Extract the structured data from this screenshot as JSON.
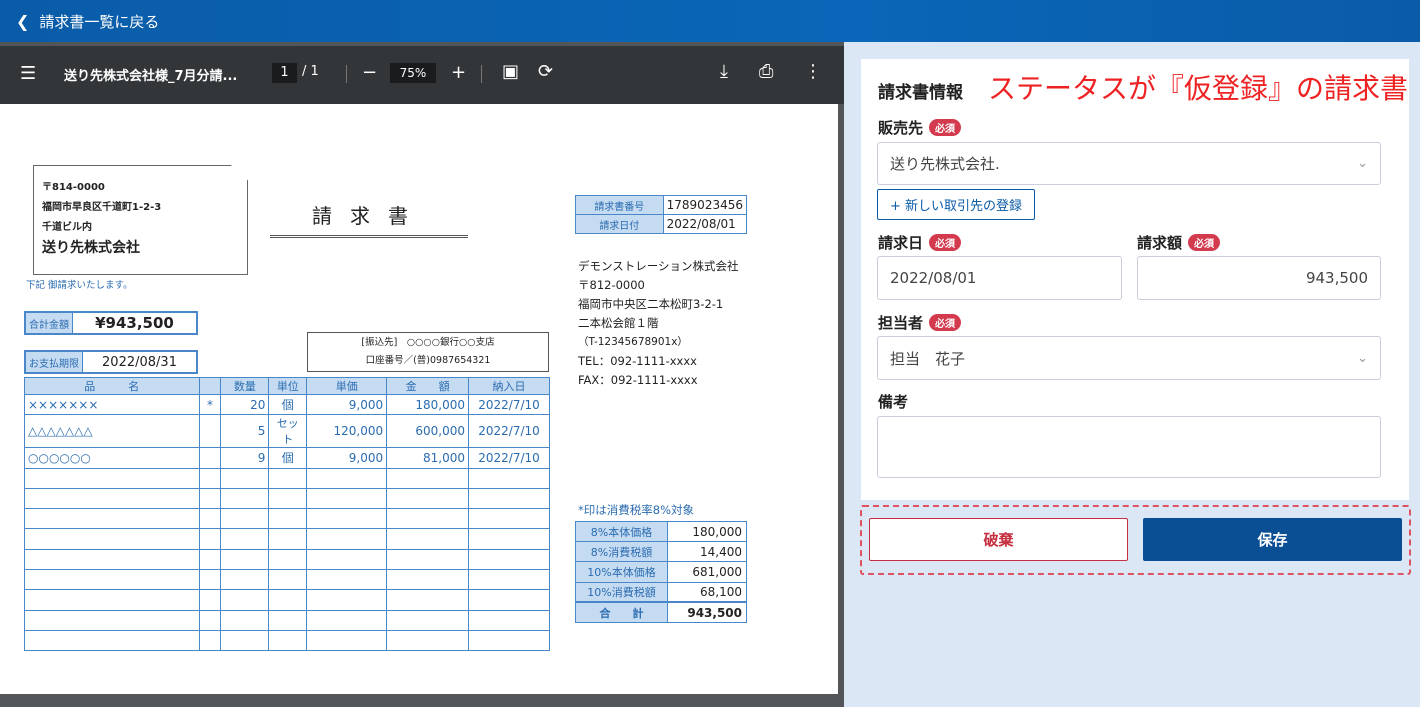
{
  "topbar": {
    "back_label": "請求書一覧に戻る"
  },
  "pdf": {
    "filename": "送り先株式会社様_7月分請...",
    "page": "1",
    "total": "/ 1",
    "zoom": "75%"
  },
  "doc": {
    "addr_zip": "〒814-0000",
    "addr_line1": "福岡市早良区千道町1-2-3",
    "addr_line2": "千道ビル内",
    "addr_name": "送り先株式会社",
    "note": "下記 御請求いたします。",
    "title": "請求書",
    "total_label": "合計金額",
    "total_value": "¥943,500",
    "due_label": "お支払期限",
    "due_value": "2022/08/31",
    "bank_line1": "[振込先]　○○○○銀行○○支店",
    "bank_line2": "口座番号／(普)0987654321",
    "inv_no_label": "請求書番号",
    "inv_no": "1789023456",
    "inv_date_label": "請求日付",
    "inv_date": "2022/08/01",
    "issuer": [
      "デモンストレーション株式会社",
      "〒812-0000",
      "福岡市中央区二本松町3-2-1",
      "二本松会館１階",
      "（T-12345678901x）",
      "TEL：092-1111-xxxx",
      "FAX：092-1111-xxxx"
    ],
    "headers": [
      "品　　　名",
      "",
      "数量",
      "単位",
      "単価",
      "金　　額",
      "納入日"
    ],
    "rows": [
      [
        "×××××××",
        "*",
        "20",
        "個",
        "9,000",
        "180,000",
        "2022/7/10"
      ],
      [
        "△△△△△△△",
        "",
        "5",
        "セット",
        "120,000",
        "600,000",
        "2022/7/10"
      ],
      [
        "○○○○○○",
        "",
        "9",
        "個",
        "9,000",
        "81,000",
        "2022/7/10"
      ]
    ],
    "tax_note": "*印は消費税率8%対象",
    "summary": [
      [
        "8%本体価格",
        "180,000"
      ],
      [
        "8%消費税額",
        "14,400"
      ],
      [
        "10%本体価格",
        "681,000"
      ],
      [
        "10%消費税額",
        "68,100"
      ],
      [
        "合　　計",
        "943,500"
      ]
    ]
  },
  "form": {
    "heading": "請求書情報",
    "status_note": "ステータスが『仮登録』の請求書",
    "required": "必須",
    "seller_label": "販売先",
    "seller_value": "送り先株式会社.",
    "new_partner": "+ 新しい取引先の登録",
    "date_label": "請求日",
    "date_value": "2022/08/01",
    "amount_label": "請求額",
    "amount_value": "943,500",
    "person_label": "担当者",
    "person_value": "担当　花子",
    "memo_label": "備考",
    "memo_value": "",
    "discard": "破棄",
    "save": "保存"
  }
}
